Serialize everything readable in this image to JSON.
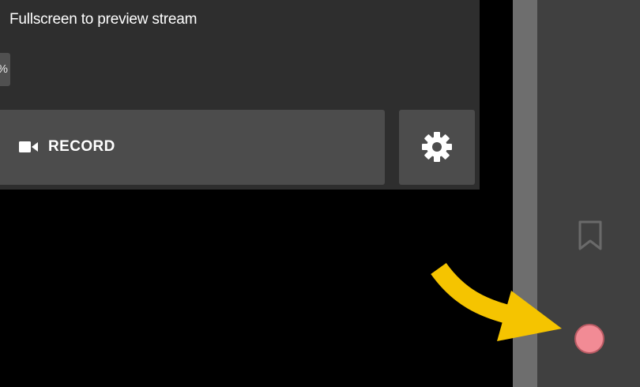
{
  "panel": {
    "preview_text": "Fullscreen to preview stream",
    "percent_fragment": "%",
    "record_label": "RECORD"
  },
  "icons": {
    "record": "video-camera-icon",
    "settings": "gear-icon",
    "bookmark": "bookmark-icon",
    "record_dot": "record-dot-icon",
    "annotation": "curved-arrow-icon"
  },
  "colors": {
    "background": "#000000",
    "panel": "#2e2e2e",
    "button": "#4c4c4c",
    "sidebar": "#404040",
    "record_dot": "#f28b95",
    "arrow": "#f5c400"
  }
}
